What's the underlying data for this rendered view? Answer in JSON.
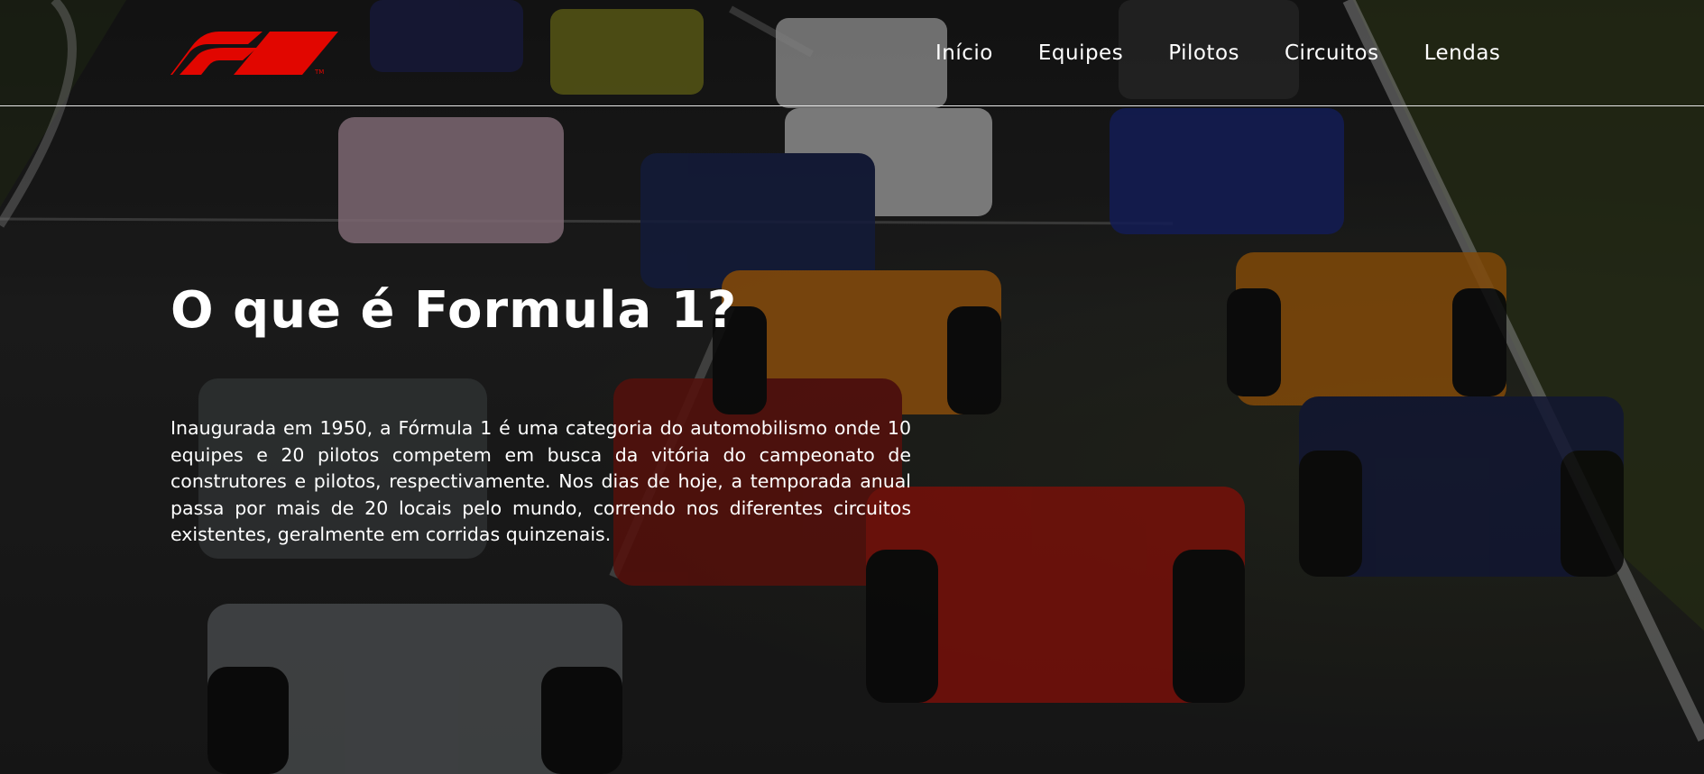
{
  "header": {
    "brand": "F1",
    "nav": {
      "items": [
        {
          "label": "Início"
        },
        {
          "label": "Equipes"
        },
        {
          "label": "Pilotos"
        },
        {
          "label": "Circuitos"
        },
        {
          "label": "Lendas"
        }
      ]
    }
  },
  "main": {
    "title": "O que é Formula 1?",
    "intro": "Inaugurada em 1950, a Fórmula 1 é uma categoria do automobilismo onde 10 equipes e 20 pilotos competem em busca da vitória do campeonato de construtores e pilotos, respectivamente. Nos dias de hoje, a temporada anual passa por mais de 20 locais pelo mundo, correndo nos diferentes circuitos existentes, geralmente em corridas quinzenais."
  },
  "colors": {
    "brand_red": "#e10600",
    "text": "#ffffff",
    "divider": "#e8e8e8"
  },
  "icons": {
    "logo": "f1-logo-icon"
  }
}
